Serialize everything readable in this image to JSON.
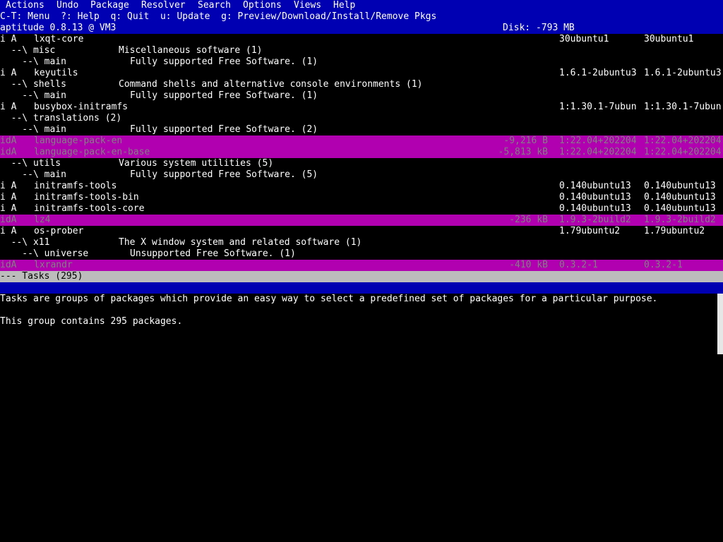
{
  "menubar": {
    "items": [
      "Actions",
      "Undo",
      "Package",
      "Resolver",
      "Search",
      "Options",
      "Views",
      "Help"
    ]
  },
  "helpbar": {
    "text": "C-T: Menu  ?: Help  q: Quit  u: Update  g: Preview/Download/Install/Remove Pkgs"
  },
  "statusbar": {
    "title": "aptitude 0.8.13 @ VM3",
    "disk": "Disk: -793 MB"
  },
  "list": {
    "rows": [
      {
        "flags": "i A",
        "name": "lxqt-core",
        "size": "",
        "cur": "30ubuntu1",
        "cand": "30ubuntu1",
        "selected": false
      },
      {
        "tree": "  --\\ misc",
        "desc": "Miscellaneous software (1)"
      },
      {
        "tree": "    --\\ main",
        "desc": "Fully supported Free Software. (1)",
        "sub": true
      },
      {
        "flags": "i A",
        "name": "keyutils",
        "size": "",
        "cur": "1.6.1-2ubuntu3",
        "cand": "1.6.1-2ubuntu3",
        "selected": false
      },
      {
        "tree": "  --\\ shells",
        "desc": "Command shells and alternative console environments (1)"
      },
      {
        "tree": "    --\\ main",
        "desc": "Fully supported Free Software. (1)",
        "sub": true
      },
      {
        "flags": "i A",
        "name": "busybox-initramfs",
        "size": "",
        "cur": "1:1.30.1-7ubun",
        "cand": "1:1.30.1-7ubun",
        "selected": false
      },
      {
        "tree": "  --\\ translations (2)",
        "desc": ""
      },
      {
        "tree": "    --\\ main",
        "desc": "Fully supported Free Software. (2)",
        "sub": true
      },
      {
        "flags": "idA",
        "name": "language-pack-en",
        "size": "-9,216 B",
        "cur": "1:22.04+202204",
        "cand": "1:22.04+202204",
        "selected": true
      },
      {
        "flags": "idA",
        "name": "language-pack-en-base",
        "size": "-5,813 kB",
        "cur": "1:22.04+202204",
        "cand": "1:22.04+202204",
        "selected": true
      },
      {
        "tree": "  --\\ utils",
        "desc": "Various system utilities (5)"
      },
      {
        "tree": "    --\\ main",
        "desc": "Fully supported Free Software. (5)",
        "sub": true
      },
      {
        "flags": "i A",
        "name": "initramfs-tools",
        "size": "",
        "cur": "0.140ubuntu13",
        "cand": "0.140ubuntu13",
        "selected": false
      },
      {
        "flags": "i A",
        "name": "initramfs-tools-bin",
        "size": "",
        "cur": "0.140ubuntu13",
        "cand": "0.140ubuntu13",
        "selected": false
      },
      {
        "flags": "i A",
        "name": "initramfs-tools-core",
        "size": "",
        "cur": "0.140ubuntu13",
        "cand": "0.140ubuntu13",
        "selected": false
      },
      {
        "flags": "idA",
        "name": "lz4",
        "size": "-236 kB",
        "cur": "1.9.3-2build2",
        "cand": "1.9.3-2build2",
        "selected": true
      },
      {
        "flags": "i A",
        "name": "os-prober",
        "size": "",
        "cur": "1.79ubuntu2",
        "cand": "1.79ubuntu2",
        "selected": false
      },
      {
        "tree": "  --\\ x11",
        "desc": "The X window system and related software (1)"
      },
      {
        "tree": "    --\\ universe",
        "desc": "Unsupported Free Software. (1)",
        "sub": true
      },
      {
        "flags": "idA",
        "name": "lxrandr",
        "size": "-410 kB",
        "cur": "0.3.2-1",
        "cand": "0.3.2-1",
        "selected": true
      }
    ],
    "tasks_header": "--- Tasks (295)"
  },
  "description": {
    "line1": "Tasks are groups of packages which provide an easy way to select a predefined set of packages for a particular purpose.",
    "line2": "This group contains 295 packages."
  },
  "colors": {
    "bar_blue": "#0000b3",
    "selected_magenta": "#b000b0",
    "tasks_gray": "#bcbcbc"
  }
}
